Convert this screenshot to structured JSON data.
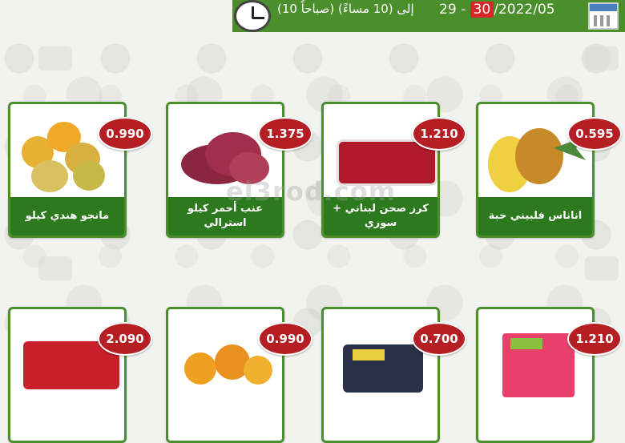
{
  "header": {
    "hours": "(10 صباحاً) إلى (10 مساءً)",
    "date_day_from": "29",
    "date_sep": " - ",
    "date_day_to": "30",
    "date_rest": "/2022/05",
    "colors": {
      "bar": "#4a8f2c",
      "price": "#b51e23",
      "label": "#2d7a1e"
    }
  },
  "watermark": "el3rod.com",
  "products": [
    {
      "label": "مانجو هندي كيلو",
      "price": "0.990",
      "icon": "mango-image"
    },
    {
      "label": "عنب أحمر كيلو استرالي",
      "price": "1.375",
      "icon": "red-grapes-image"
    },
    {
      "label": "كرز صحن لبناني + سوري",
      "price": "1.210",
      "icon": "cherry-tray-image"
    },
    {
      "label": "اناناس فلبيني حبة",
      "price": "0.595",
      "icon": "pineapple-image"
    }
  ],
  "products_row2": [
    {
      "price": "2.090",
      "icon": "strawberry-image"
    },
    {
      "price": "0.990",
      "icon": "persimmon-image"
    },
    {
      "price": "0.700",
      "icon": "blueberry-image"
    },
    {
      "price": "1.210",
      "icon": "raspberry-image"
    }
  ]
}
